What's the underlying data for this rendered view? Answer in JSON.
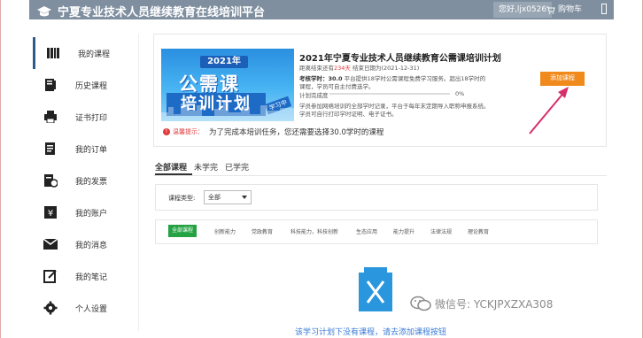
{
  "header": {
    "title": "宁夏专业技术人员继续教育在线培训平台",
    "user_chip": "您好,ljx0526",
    "cart_label": "购物车"
  },
  "sidebar": {
    "items": [
      {
        "label": "我的课程",
        "icon": "books-icon"
      },
      {
        "label": "历史课程",
        "icon": "history-book-icon"
      },
      {
        "label": "证书打印",
        "icon": "printer-icon"
      },
      {
        "label": "我的订单",
        "icon": "order-icon"
      },
      {
        "label": "我的发票",
        "icon": "invoice-icon"
      },
      {
        "label": "我的账户",
        "icon": "yen-account-icon"
      },
      {
        "label": "我的消息",
        "icon": "envelope-icon"
      },
      {
        "label": "我的笔记",
        "icon": "note-icon"
      },
      {
        "label": "个人设置",
        "icon": "gear-icon"
      }
    ]
  },
  "course": {
    "banner": {
      "year": "2021年",
      "line1": "公需课",
      "line2": "培训计划",
      "tag": "学习中"
    },
    "title": "2021年宁夏专业技术人员继续教育公需课培训计划",
    "deadline_prefix": "距离结束还有",
    "deadline_days": "234天",
    "deadline_suffix": "  结束日期为(2021-12-31)",
    "hours_label": "考核学时：30.0",
    "hours_desc": "平台提供18学时公需课程免费学习服务。超出18学时的",
    "hours_desc2": "课程，学员可自主付费选学。",
    "progress_label": "计划完成度",
    "progress_pct": "0%",
    "progress_value": 0,
    "note1": "学员参加网络培训的全部学时记录，平台于每年末定期导入职称申报系统。",
    "note2": "学员可自行打印学时证明、电子证书。",
    "add_button": "添加课程",
    "notice_label": "温馨提示：",
    "notice_msg": "为了完成本培训任务，您还需要选择30.0学时的课程"
  },
  "tabs": [
    {
      "label": "全部课程"
    },
    {
      "label": "未学完"
    },
    {
      "label": "已学完"
    }
  ],
  "filter": {
    "label": "课程类型:",
    "selected": "全部"
  },
  "categories": [
    "全部课程",
    "创新能力",
    "党政教育",
    "科技能力，科技创新",
    "生态应用",
    "能力提升",
    "法律法规",
    "理论教育"
  ],
  "empty": {
    "text": "该学习计划下没有课程，请去添加课程按钮"
  },
  "watermark": {
    "text": "微信号: YCKJPXZXA308"
  },
  "colors": {
    "header_bg": "#7f8fa0",
    "accent_orange": "#f08a1c",
    "accent_green": "#25a244",
    "accent_red": "#e03b3b"
  }
}
